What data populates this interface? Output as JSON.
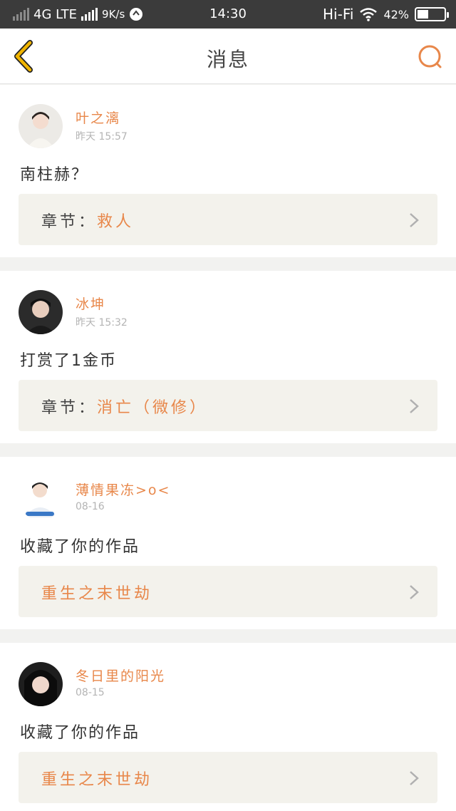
{
  "status_bar": {
    "network": "4G LTE",
    "speed": "9K/s",
    "time": "14:30",
    "hifi": "Hi-Fi",
    "battery": "42%",
    "battery_level": 0.42
  },
  "header": {
    "title": "消息",
    "back_icon": "chevron-left-icon",
    "search_icon": "search-icon"
  },
  "colors": {
    "accent": "#e8874a",
    "back_icon": "#f0b400",
    "page_bg": "#f2f2f0",
    "card_bg": "#ffffff",
    "link_bg": "#f3f2ec"
  },
  "messages": [
    {
      "name": "叶之漓",
      "time": "昨天 15:57",
      "content": "南柱赫？",
      "link_prefix": "章节：",
      "link_value": "救人"
    },
    {
      "name": "冰坤",
      "time": "昨天 15:32",
      "content": "打赏了1金币",
      "link_prefix": "章节：",
      "link_value": "消亡（微修）"
    },
    {
      "name": "薄情果冻>o<",
      "time": "08-16",
      "content": "收藏了你的作品",
      "link_prefix": "",
      "link_value": "重生之末世劫"
    },
    {
      "name": "冬日里的阳光",
      "time": "08-15",
      "content": "收藏了你的作品",
      "link_prefix": "",
      "link_value": "重生之末世劫"
    }
  ]
}
